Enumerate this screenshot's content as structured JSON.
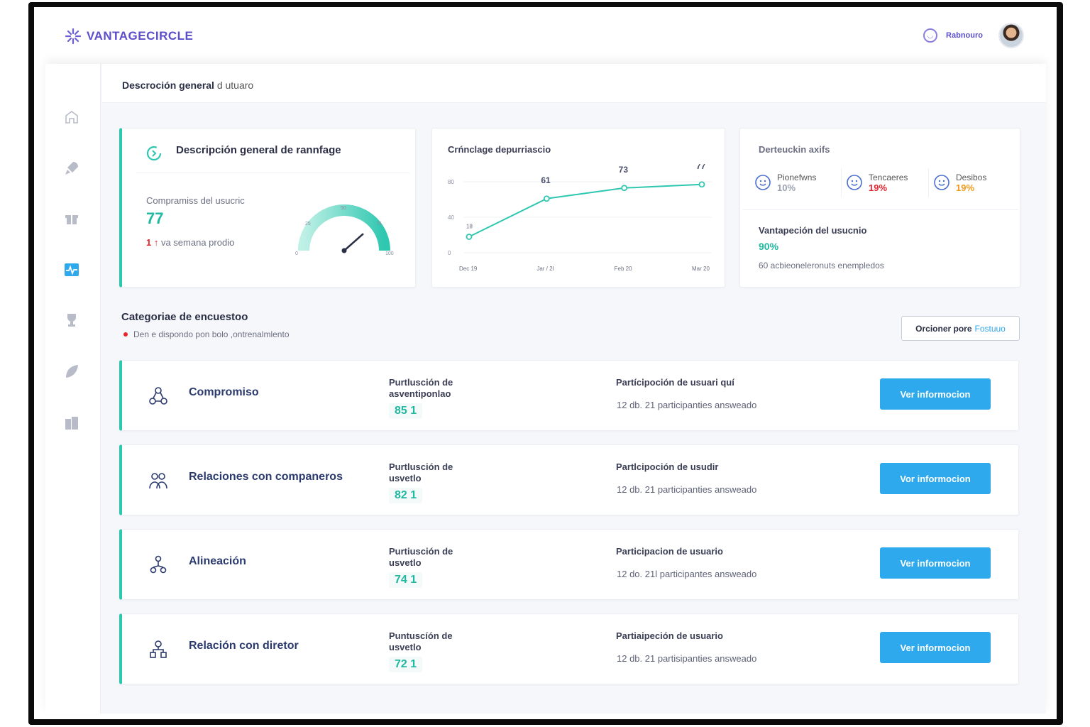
{
  "brand": {
    "name": "VANTAGECIRCLE",
    "color": "#5b4fc9"
  },
  "user": {
    "name": "Rabnouro",
    "icon": "user-circle-icon"
  },
  "page": {
    "title": "Descroción general",
    "subtitle": "d utuaro"
  },
  "sidebar": {
    "items": [
      {
        "name": "home-icon"
      },
      {
        "name": "rocket-icon"
      },
      {
        "name": "gift-icon"
      },
      {
        "name": "pulse-icon",
        "active": true
      },
      {
        "name": "trophy-icon"
      },
      {
        "name": "leaf-icon"
      },
      {
        "name": "building-icon"
      }
    ]
  },
  "overview": {
    "title": "Descripción general de rannfage",
    "label": "Compramiss del usucric",
    "value": "77",
    "change_prefix": "1 ↑",
    "change_text": "va semana prodio",
    "gauge": {
      "value": 77,
      "min_label": "0",
      "l25": "25",
      "mid": "50",
      "l75": "75",
      "max_label": "100"
    }
  },
  "trend": {
    "title": "Crńnclage depurriascio",
    "y_ticks": [
      "80",
      "40",
      "0"
    ]
  },
  "chart_data": {
    "type": "line",
    "title": "Crńnclage depurriascio",
    "categories": [
      "Dec 19",
      "Jan 20",
      "Feb 20",
      "Mar 20"
    ],
    "x_labels": [
      "Dec 19",
      "Jar / 2l",
      "Feb 20",
      "Mar 20"
    ],
    "values": [
      18,
      61,
      73,
      77
    ],
    "labels": [
      "18",
      "61",
      "73",
      "77"
    ],
    "ylim": [
      0,
      80
    ],
    "grid": true
  },
  "sentiment": {
    "title": "Derteuckin axifs",
    "items": [
      {
        "label": "Pionefwns",
        "value": "10%",
        "color": "#9aa0b0"
      },
      {
        "label": "Tencaeres",
        "value": "19%",
        "color": "#e5242b"
      },
      {
        "label": "Desibos",
        "value": "19%",
        "color": "#f39a1a"
      }
    ],
    "participation_label": "Vantapeción del usucnio",
    "participation_value": "90%",
    "participation_note": "60 acbieoneleronuts enempledos"
  },
  "survey": {
    "title": "Categoriae de encuestoo",
    "subtitle": "Den e dispondo pon bolo ,ontrenalmlento",
    "sort_label": "Orcioner pore",
    "sort_value": "Fostuuo"
  },
  "rows": [
    {
      "name": "Compromiso",
      "score_label": "Purtlusción de asventiponlao",
      "score": "85 1",
      "part_label": "Partícipoción de usuari quí",
      "part_value": "12 db. 21 participanties answeado",
      "button": "Ver informocion",
      "icon": "engagement-icon"
    },
    {
      "name": "Relaciones con companeros",
      "score_label": "Purtlusción de usvetlo",
      "score": "82 1",
      "part_label": "Partlcipoción de usudir",
      "part_value": "12 db. 21 participanties answeado",
      "button": "Vor informocion",
      "icon": "peers-icon"
    },
    {
      "name": "Alineación",
      "score_label": "Purtiusción de usvetlo",
      "score": "74 1",
      "part_label": "Participacion de usuario",
      "part_value": "12 do. 21l participantes answeado",
      "button": "Ver informocion",
      "icon": "alignment-icon"
    },
    {
      "name": "Relación con diretor",
      "score_label": "Puntuscíón de usvetlo",
      "score": "72 1",
      "part_label": "Partiaipeción de usuario",
      "part_value": "12 db. 21 partisipanties answeado",
      "button": "Ver informocion",
      "icon": "manager-icon"
    }
  ],
  "colors": {
    "accent": "#2ec7b0",
    "button": "#2fa9ee",
    "line": "#2ec7b0"
  }
}
